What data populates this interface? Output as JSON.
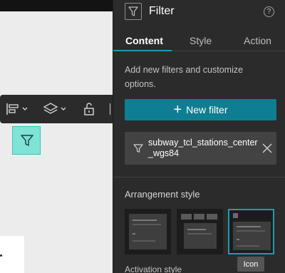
{
  "panel": {
    "title": "Filter",
    "help_glyph": "?",
    "header_icon": "filter-icon"
  },
  "tabs": [
    {
      "label": "Content",
      "active": true
    },
    {
      "label": "Style",
      "active": false
    },
    {
      "label": "Action",
      "active": false
    }
  ],
  "content": {
    "description": "Add new filters and customize options.",
    "new_filter_label": "New filter",
    "filters": [
      {
        "label": "subway_tcl_stations_center_wgs84"
      }
    ],
    "arrangement_label": "Arrangement style",
    "arrangement_styles": [
      {
        "selected": false
      },
      {
        "selected": false
      },
      {
        "selected": true
      }
    ],
    "tooltip": "Icon",
    "activation_label": "Activation style"
  },
  "toolbar": {
    "icons": [
      "align-icon",
      "layers-icon",
      "lock-icon"
    ]
  },
  "colors": {
    "accent": "#1e9bb1",
    "button": "#0f7e92",
    "panel_bg": "#2b2b2b",
    "widget_fill": "#7fe3d6"
  }
}
